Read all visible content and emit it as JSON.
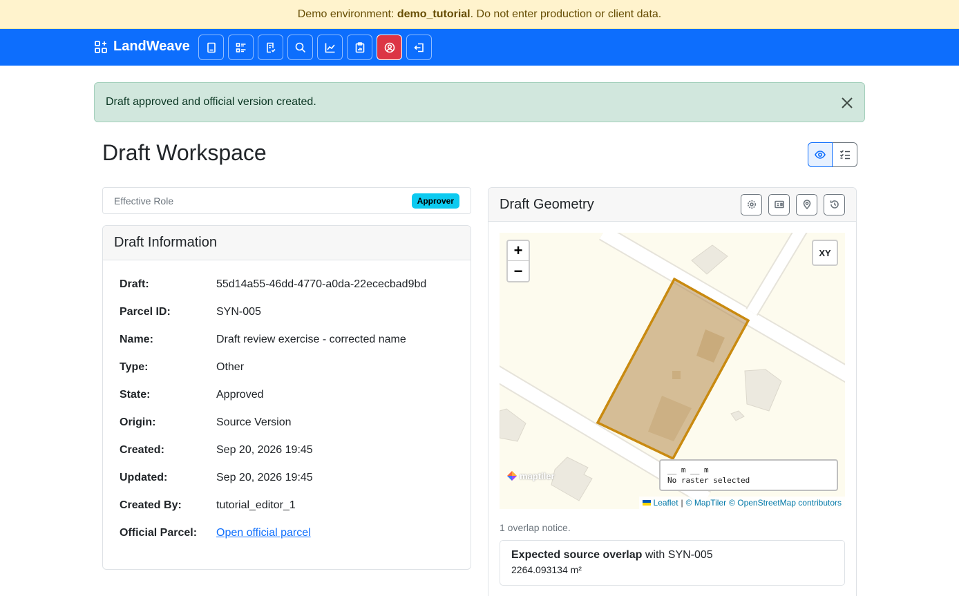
{
  "banner": {
    "prefix": "Demo environment: ",
    "env_name": "demo_tutorial",
    "suffix": ". Do not enter production or client data."
  },
  "navbar": {
    "brand": "LandWeave",
    "icons": [
      "book-icon",
      "list-details-icon",
      "file-check-icon",
      "search-icon",
      "chart-icon",
      "clipboard-icon",
      "user-circle-icon",
      "logout-icon"
    ]
  },
  "alert": {
    "message": "Draft approved and official version created."
  },
  "page": {
    "title": "Draft Workspace"
  },
  "role": {
    "label": "Effective Role",
    "badge": "Approver"
  },
  "draft_info": {
    "header": "Draft Information",
    "rows": [
      {
        "key": "Draft:",
        "value": "55d14a55-46dd-4770-a0da-22ececbad9bd"
      },
      {
        "key": "Parcel ID:",
        "value": "SYN-005"
      },
      {
        "key": "Name:",
        "value": "Draft review exercise - corrected name"
      },
      {
        "key": "Type:",
        "value": "Other"
      },
      {
        "key": "State:",
        "value": "Approved"
      },
      {
        "key": "Origin:",
        "value": "Source Version"
      },
      {
        "key": "Created:",
        "value": "Sep 20, 2026 19:45"
      },
      {
        "key": "Updated:",
        "value": "Sep 20, 2026 19:45"
      },
      {
        "key": "Created By:",
        "value": "tutorial_editor_1"
      },
      {
        "key": "Official Parcel:",
        "value": "Open official parcel"
      }
    ]
  },
  "geometry": {
    "header": "Draft Geometry",
    "zoom_in": "+",
    "zoom_out": "−",
    "xy_label": "XY",
    "coord_line1": "__ m __ m",
    "coord_line2": "No raster selected",
    "maptiler_logo": "maptiler",
    "attribution": {
      "leaflet": "Leaflet",
      "sep": "|",
      "maptiler": "© MapTiler",
      "osm": "© OpenStreetMap contributors"
    },
    "overlap_notice": "1 overlap notice.",
    "overlap": {
      "title_bold": "Expected source overlap",
      "title_rest": " with SYN-005",
      "area": "2264.093134 m²"
    }
  },
  "colors": {
    "navbar": "#0d6efd",
    "danger": "#dc3545",
    "alert_bg": "#d1e7dd",
    "badge": "#0dcaf0",
    "parcel_outline": "#c98a10",
    "map_bg": "#fdfbee"
  }
}
